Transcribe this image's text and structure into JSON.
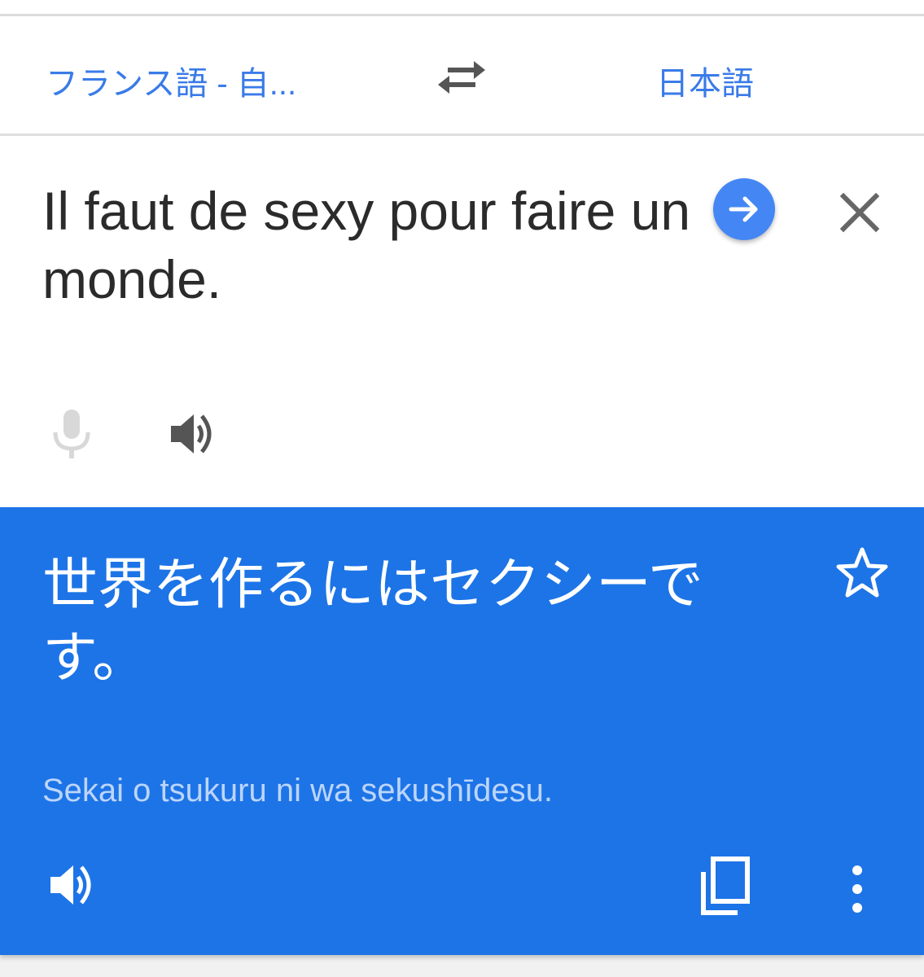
{
  "language_bar": {
    "source_language": "フランス語 - 自...",
    "target_language": "日本語",
    "swap_icon": "swap-horiz-icon"
  },
  "input": {
    "text": "Il faut de sexy pour faire un monde.",
    "go_icon": "arrow-forward-icon",
    "clear_icon": "close-icon",
    "mic_icon": "microphone-icon",
    "speaker_icon": "volume-up-icon"
  },
  "result": {
    "translation": "世界を作るにはセクシーです。",
    "romanization": "Sekai o tsukuru ni wa sekushīdesu.",
    "star_icon": "star-outline-icon",
    "speaker_icon": "volume-up-icon",
    "copy_icon": "copy-icon",
    "more_icon": "more-vert-icon"
  },
  "colors": {
    "accent_blue": "#3a7be8",
    "go_button": "#4486f4",
    "result_background": "#1d74e7",
    "romanization_text": "#bcd5fb"
  }
}
